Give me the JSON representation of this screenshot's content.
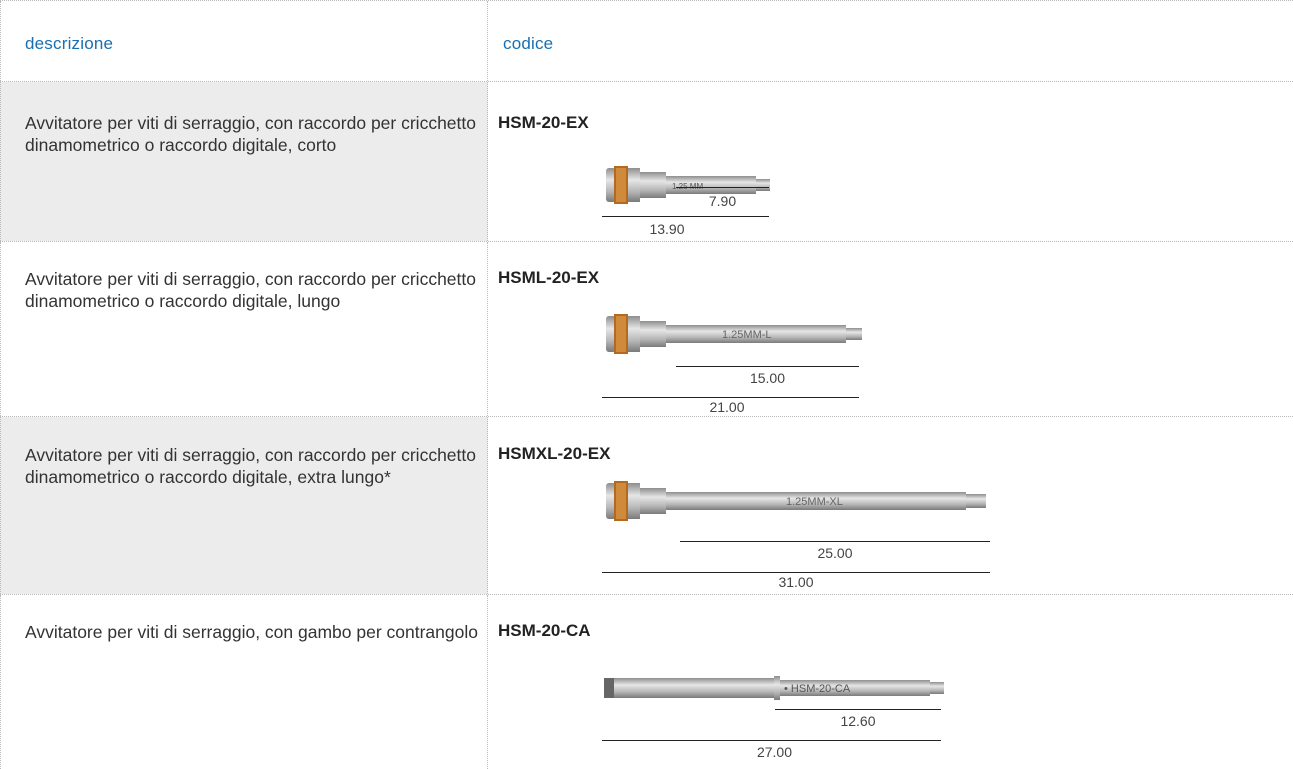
{
  "header": {
    "col_description": "descrizione",
    "col_code": "codice"
  },
  "rows": [
    {
      "description": "Avvitatore per viti di serraggio, con raccordo per cricchetto dinamometrico o raccordo digitale, corto",
      "code": "HSM-20-EX",
      "tool_marking": "1.25 MM",
      "dim_inner": "7.90",
      "dim_outer": "13.90"
    },
    {
      "description": "Avvitatore per viti di serraggio, con raccordo per cricchetto dinamometrico o raccordo digitale, lungo",
      "code": "HSML-20-EX",
      "tool_marking": "1.25MM-L",
      "dim_inner": "15.00",
      "dim_outer": "21.00"
    },
    {
      "description": "Avvitatore per viti di serraggio, con raccordo per cricchetto dinamometrico o raccordo digitale, extra lungo*",
      "code": "HSMXL-20-EX",
      "tool_marking": "1.25MM-XL",
      "dim_inner": "25.00",
      "dim_outer": "31.00"
    },
    {
      "description": "Avvitatore per viti di serraggio, con gambo per contrangolo",
      "code": "HSM-20-CA",
      "tool_marking": "• HSM-20-CA",
      "dim_inner": "12.60",
      "dim_outer": "27.00"
    }
  ]
}
